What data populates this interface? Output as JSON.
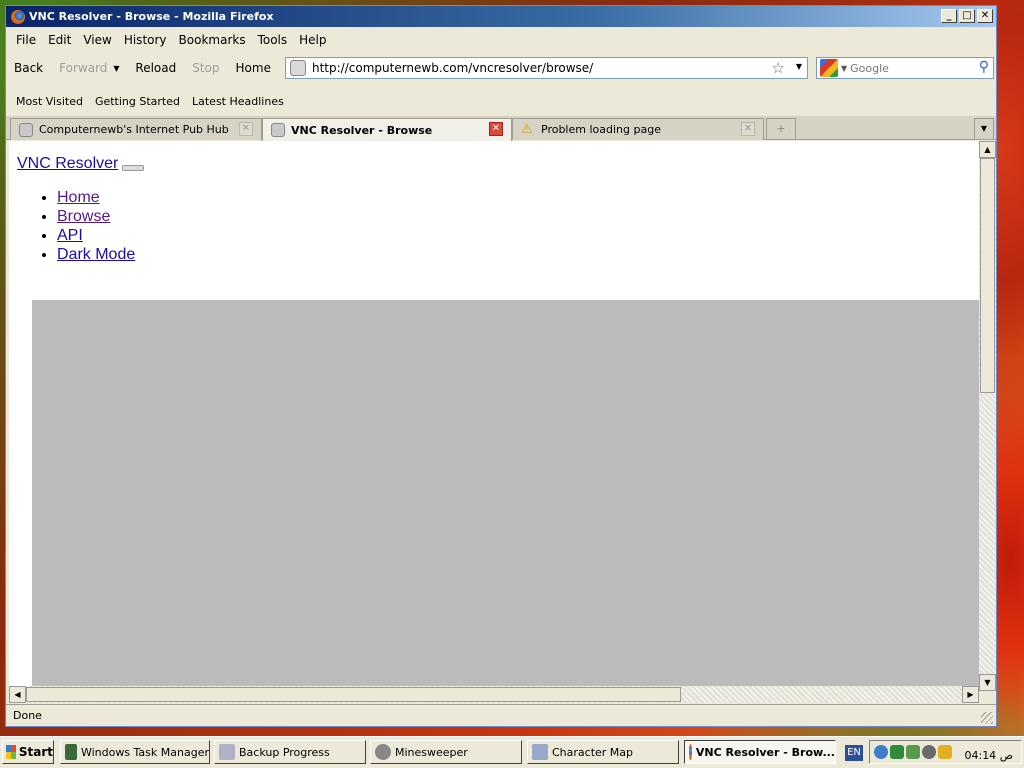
{
  "window": {
    "title": "VNC Resolver - Browse - Mozilla Firefox",
    "controls": {
      "minimize": "_",
      "maximize": "□",
      "close": "✕"
    }
  },
  "menu": [
    "File",
    "Edit",
    "View",
    "History",
    "Bookmarks",
    "Tools",
    "Help"
  ],
  "navigation": {
    "back": "Back",
    "forward": "Forward",
    "reload": "Reload",
    "stop": "Stop",
    "home": "Home",
    "url": "http://computernewb.com/vncresolver/browse/",
    "search_placeholder": "Google"
  },
  "bookmarks": [
    "Most Visited",
    "Getting Started",
    "Latest Headlines"
  ],
  "tabs": [
    {
      "title": "Computernewb's Internet Pub Hub",
      "active": false
    },
    {
      "title": "VNC Resolver - Browse",
      "active": true
    },
    {
      "title": "Problem loading page",
      "active": false
    }
  ],
  "page": {
    "brand": "VNC Resolver",
    "nav": [
      "Home",
      "Browse",
      "API",
      "Dark Mode"
    ]
  },
  "status": "Done",
  "taskbar": {
    "start": "Start",
    "tasks": [
      "Windows Task Manager",
      "Backup Progress",
      "Minesweeper",
      "Character Map",
      "VNC Resolver - Brow..."
    ],
    "language": "EN",
    "clock": "04:14 ص"
  },
  "colors": {
    "link": "#1a0dab",
    "visited": "#551a8b",
    "titlebar": "#0a246a",
    "panel_gray": "#bbbbbb"
  }
}
